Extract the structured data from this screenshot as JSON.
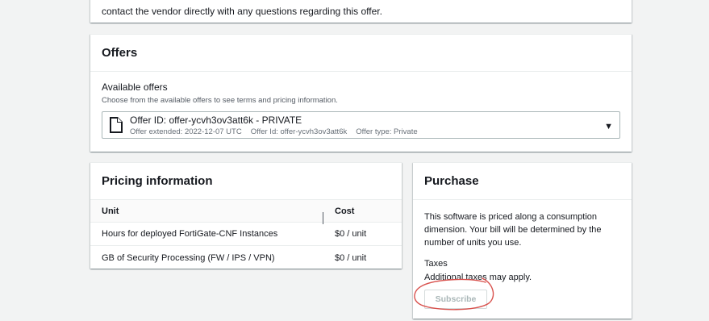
{
  "top_card": {
    "text": "contact the vendor directly with any questions regarding this offer."
  },
  "offers": {
    "title": "Offers",
    "available_label": "Available offers",
    "available_desc": "Choose from the available offers to see terms and pricing information.",
    "selected": {
      "title": "Offer ID: offer-ycvh3ov3att6k - PRIVATE",
      "extended": "Offer extended: 2022-12-07 UTC",
      "offer_id": "Offer Id: offer-ycvh3ov3att6k",
      "type": "Offer type: Private"
    },
    "icon": "document-icon",
    "caret_icon": "caret-down-icon"
  },
  "pricing": {
    "title": "Pricing information",
    "columns": {
      "unit": "Unit",
      "cost": "Cost"
    },
    "rows": [
      {
        "unit": "Hours for deployed FortiGate-CNF Instances",
        "cost": "$0 / unit"
      },
      {
        "unit": "GB of Security Processing (FW / IPS / VPN)",
        "cost": "$0 / unit"
      }
    ]
  },
  "purchase": {
    "title": "Purchase",
    "description": "This software is priced along a consumption dimension. Your bill will be determined by the number of units you use.",
    "taxes_label": "Taxes",
    "taxes_text": "Additional taxes may apply.",
    "subscribe_label": "Subscribe"
  },
  "colors": {
    "page_bg": "#f2f3f3",
    "annotation_circle": "#d9534f",
    "disabled_text": "#aab7b8"
  }
}
